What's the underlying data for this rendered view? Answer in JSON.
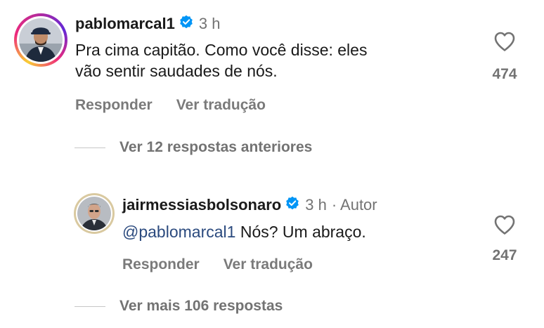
{
  "comments": [
    {
      "username": "pablomarcal1",
      "verified": true,
      "time": "3 h",
      "author_tag": "",
      "text_lines": [
        "Pra cima capitão. Como você disse: eles",
        "vão sentir saudades de nós."
      ],
      "reply_label": "Responder",
      "translate_label": "Ver tradução",
      "likes": "474",
      "replies_toggle": "Ver 12 respostas anteriores"
    },
    {
      "username": "jairmessiasbolsonaro",
      "verified": true,
      "time": "3 h",
      "author_tag": "· Autor",
      "mention": "@pablomarcal1",
      "text": " Nós? Um abraço.",
      "reply_label": "Responder",
      "translate_label": "Ver tradução",
      "likes": "247",
      "replies_toggle": "Ver mais 106 respostas"
    }
  ],
  "icons": {
    "verified": "verified-badge-icon",
    "like": "heart-icon"
  },
  "colors": {
    "verified_blue": "#0095f6",
    "mention": "#2b4a7e",
    "meta_gray": "#737373"
  }
}
